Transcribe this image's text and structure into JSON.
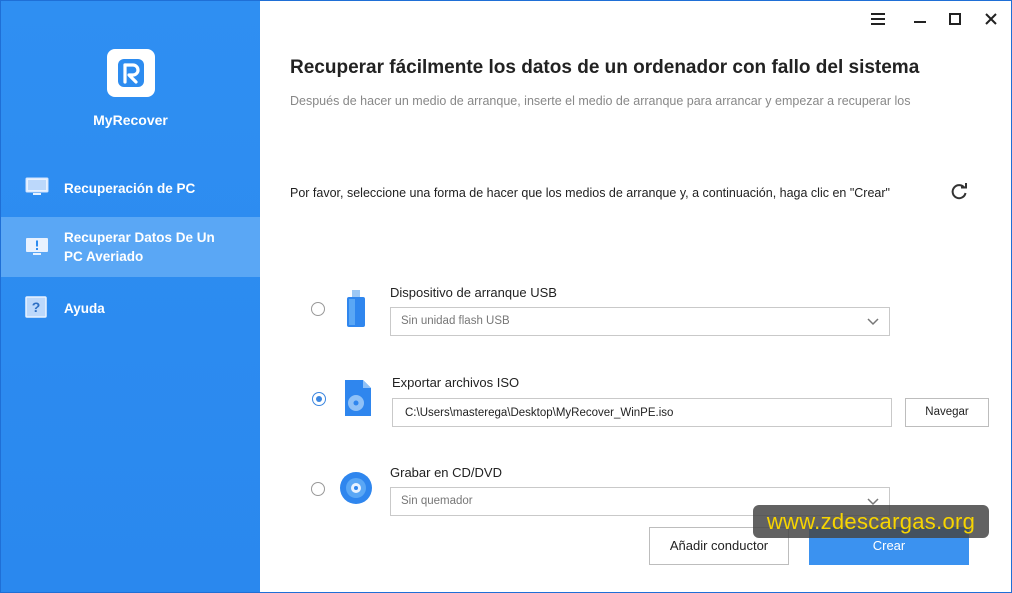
{
  "app": {
    "name": "MyRecover",
    "logo_letter": "R"
  },
  "sidebar": {
    "items": [
      {
        "label": "Recuperación de PC",
        "icon": "monitor-icon"
      },
      {
        "label": "Recuperar Datos De Un PC Averiado",
        "icon": "warning-monitor-icon",
        "active": true
      },
      {
        "label": "Ayuda",
        "icon": "help-icon"
      }
    ]
  },
  "window_controls": [
    "menu-icon",
    "minimize-icon",
    "maximize-icon",
    "close-icon"
  ],
  "main": {
    "title": "Recuperar fácilmente los datos de un ordenador con fallo del sistema",
    "subtitle": "Después de hacer un medio de arranque, inserte el medio de arranque para arrancar y empezar a recuperar los",
    "instruction": "Por favor, seleccione una forma de hacer que los medios de arranque y, a continuación, haga clic en \"Crear\"",
    "options": {
      "usb": {
        "label": "Dispositivo de arranque USB",
        "select_value": "Sin unidad flash USB",
        "checked": false
      },
      "iso": {
        "label": "Exportar archivos ISO",
        "path_value": "C:\\Users\\masterega\\Desktop\\MyRecover_WinPE.iso",
        "browse_label": "Navegar",
        "checked": true
      },
      "cd": {
        "label": "Grabar en CD/DVD",
        "select_value": "Sin quemador",
        "checked": false
      }
    },
    "add_driver_label": "Añadir conductor",
    "create_label": "Crear"
  },
  "watermark": "www.zdescargas.org",
  "colors": {
    "sidebar": "#2d8cf0",
    "sidebar_active": "#5aa7f5",
    "primary_button": "#3b92f0",
    "watermark_text": "#f7d400"
  }
}
